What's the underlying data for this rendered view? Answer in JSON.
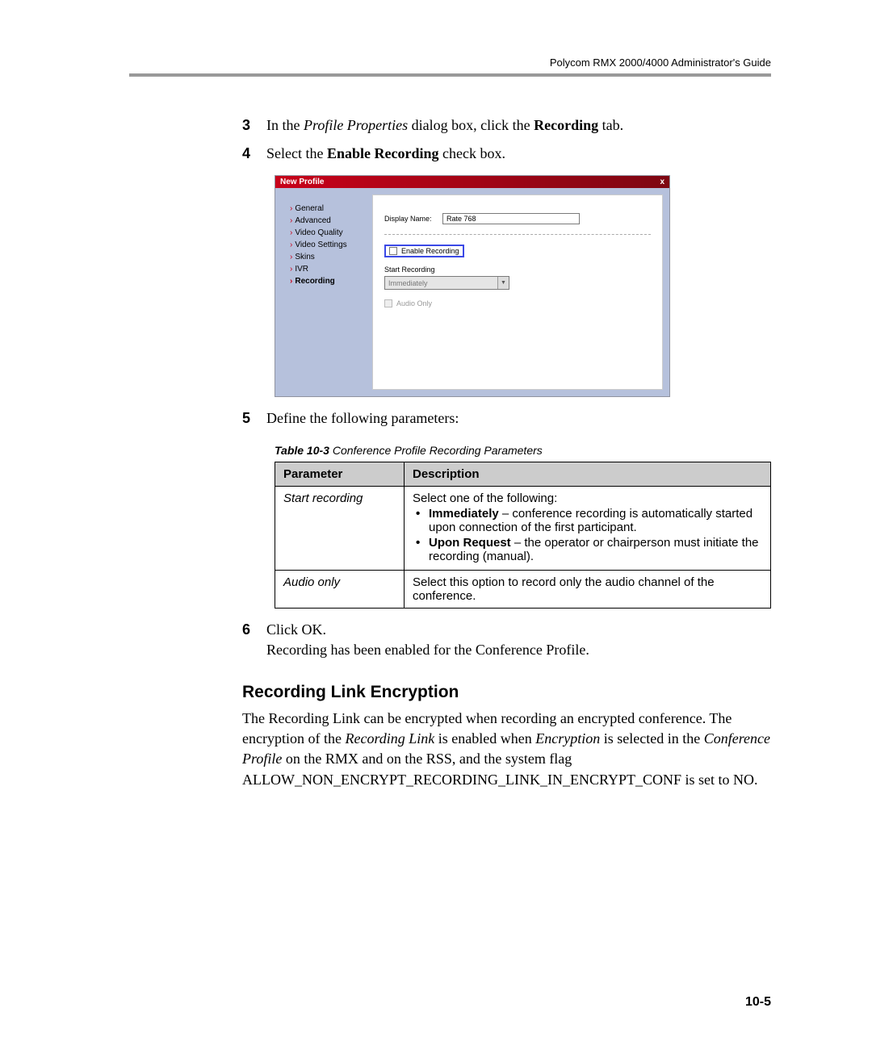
{
  "header": {
    "title": "Polycom RMX 2000/4000 Administrator's Guide"
  },
  "steps": {
    "s3": {
      "num": "3",
      "prefix": "In the ",
      "italic": "Profile Properties",
      "mid": " dialog box, click the ",
      "bold": "Recording",
      "suffix": " tab."
    },
    "s4": {
      "num": "4",
      "prefix": "Select the ",
      "bold": "Enable Recording",
      "suffix": " check box."
    },
    "s5": {
      "num": "5",
      "text": "Define the following parameters:"
    },
    "s6": {
      "num": "6",
      "text": "Click OK.",
      "line2": "Recording has been enabled for the Conference Profile."
    }
  },
  "dialog": {
    "title": "New Profile",
    "close": "x",
    "sidebar": [
      "General",
      "Advanced",
      "Video Quality",
      "Video Settings",
      "Skins",
      "IVR",
      "Recording"
    ],
    "display_name_label": "Display Name:",
    "display_name_value": "Rate 768",
    "enable_recording": "Enable Recording",
    "start_recording_label": "Start Recording",
    "start_recording_value": "Immediately",
    "audio_only": "Audio Only"
  },
  "table": {
    "caption_bold": "Table 10-3",
    "caption_rest": "  Conference Profile Recording Parameters",
    "headers": {
      "param": "Parameter",
      "desc": "Description"
    },
    "rows": [
      {
        "param": "Start recording",
        "desc_intro": "Select one of the following:",
        "bullet1_bold": "Immediately",
        "bullet1_rest": " – conference recording is automatically started upon connection of the first participant.",
        "bullet2_bold": "Upon Request",
        "bullet2_rest": " – the operator or chairperson must initiate the recording (manual)."
      },
      {
        "param": "Audio only",
        "desc": "Select this option to record only the audio channel of the conference."
      }
    ]
  },
  "section": {
    "heading": "Recording Link Encryption",
    "p_part1": "The Recording Link can be encrypted when recording an encrypted conference. The encryption of the ",
    "p_it1": "Recording Link",
    "p_part2": " is enabled when ",
    "p_it2": "Encryption",
    "p_part3": " is selected in the ",
    "p_it3": "Conference Profile",
    "p_part4": " on the RMX and on the RSS, and the system flag",
    "p_flag": "ALLOW_NON_ENCRYPT_RECORDING_LINK_IN_ENCRYPT_CONF is set to NO."
  },
  "page_number": "10-5"
}
